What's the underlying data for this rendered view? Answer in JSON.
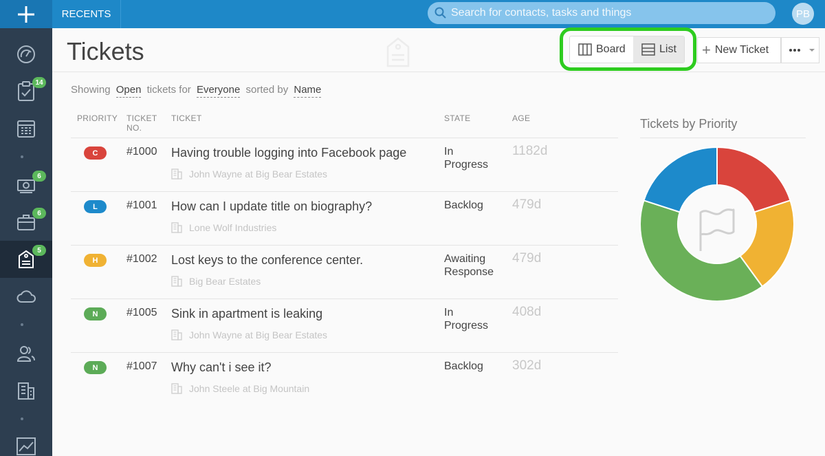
{
  "topbar": {
    "recents_label": "RECENTS",
    "search_placeholder": "Search for contacts, tasks and things",
    "avatar_initials": "PB"
  },
  "sidebar": {
    "items": [
      {
        "icon": "dashboard-gauge-icon"
      },
      {
        "icon": "tasks-clipboard-icon",
        "badge": "14"
      },
      {
        "icon": "calendar-icon"
      },
      {
        "icon": "money-icon",
        "badge": "6"
      },
      {
        "icon": "briefcase-icon",
        "badge": "6"
      },
      {
        "icon": "ticket-tag-icon",
        "badge": "5",
        "active": true
      },
      {
        "icon": "cloud-icon"
      },
      {
        "icon": "contacts-people-icon"
      },
      {
        "icon": "companies-building-icon"
      },
      {
        "icon": "reports-chart-icon"
      }
    ]
  },
  "header": {
    "title": "Tickets",
    "board_label": "Board",
    "list_label": "List",
    "new_ticket_label": "New Ticket"
  },
  "filter": {
    "showing": "Showing",
    "state": "Open",
    "tickets_for": "tickets for",
    "owner": "Everyone",
    "sorted_by": "sorted by",
    "sort": "Name"
  },
  "table": {
    "headers": {
      "priority": "PRIORITY",
      "ticket_no_1": "TICKET",
      "ticket_no_2": "NO.",
      "ticket": "TICKET",
      "state": "STATE",
      "age": "AGE"
    },
    "rows": [
      {
        "priority": "C",
        "color": "#d9443c",
        "number": "#1000",
        "subject": "Having trouble logging into Facebook page",
        "company": "John Wayne at Big Bear Estates",
        "state_1": "In",
        "state_2": "Progress",
        "age": "1182d"
      },
      {
        "priority": "L",
        "color": "#1d8acb",
        "number": "#1001",
        "subject": "How can I update title on biography?",
        "company": "Lone Wolf Industries",
        "state_1": "Backlog",
        "state_2": "",
        "age": "479d"
      },
      {
        "priority": "H",
        "color": "#f0b233",
        "number": "#1002",
        "subject": "Lost keys to the conference center.",
        "company": "Big Bear Estates",
        "state_1": "Awaiting",
        "state_2": "Response",
        "age": "479d"
      },
      {
        "priority": "N",
        "color": "#5cab57",
        "number": "#1005",
        "subject": "Sink in apartment is leaking",
        "company": "John Wayne at Big Bear Estates",
        "state_1": "In",
        "state_2": "Progress",
        "age": "408d"
      },
      {
        "priority": "N",
        "color": "#5cab57",
        "number": "#1007",
        "subject": "Why can't i see it?",
        "company": "John Steele at Big Mountain",
        "state_1": "Backlog",
        "state_2": "",
        "age": "302d"
      }
    ]
  },
  "chart_data": {
    "type": "pie",
    "title": "Tickets by Priority",
    "donut": true,
    "center_icon": "flag-icon",
    "slices": [
      {
        "label": "C",
        "value": 1,
        "color": "#d9443c"
      },
      {
        "label": "H",
        "value": 1,
        "color": "#f0b233"
      },
      {
        "label": "N",
        "value": 2,
        "color": "#6ab058"
      },
      {
        "label": "L",
        "value": 1,
        "color": "#1d8acb"
      }
    ]
  }
}
